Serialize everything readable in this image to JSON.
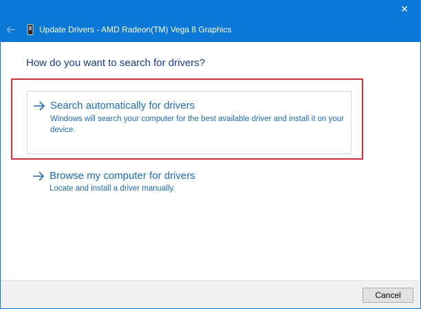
{
  "window": {
    "title": "Update Drivers - AMD Radeon(TM) Vega 8 Graphics",
    "close_glyph": "✕",
    "accent_color": "#0a78d7"
  },
  "main": {
    "question": "How do you want to search for drivers?",
    "options": [
      {
        "title": "Search automatically for drivers",
        "description": "Windows will search your computer for the best available driver and install it on your device.",
        "highlighted": true
      },
      {
        "title": "Browse my computer for drivers",
        "description": "Locate and install a driver manually.",
        "highlighted": false
      }
    ],
    "highlight_color": "#c8313b"
  },
  "footer": {
    "cancel_label": "Cancel"
  },
  "icons": {
    "back": "back-arrow-icon",
    "device": "graphics-device-icon",
    "option_arrow": "right-arrow-icon"
  }
}
